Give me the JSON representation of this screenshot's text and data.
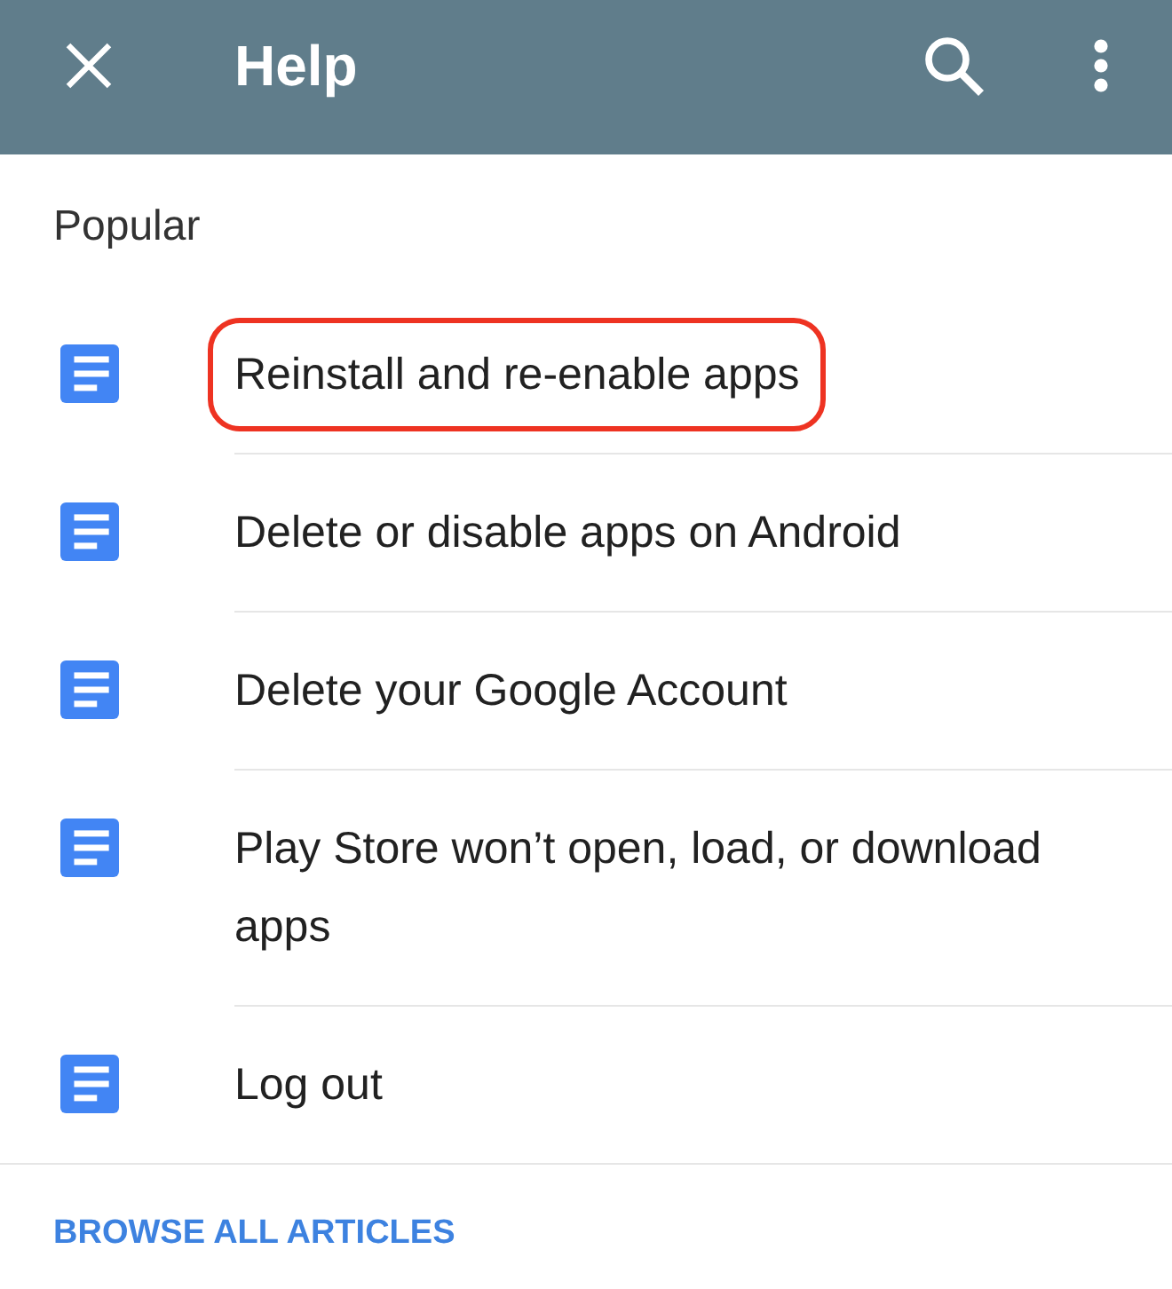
{
  "app_bar": {
    "title": "Help"
  },
  "popular": {
    "heading": "Popular",
    "articles": [
      {
        "title": "Reinstall and re-enable apps",
        "highlighted": true
      },
      {
        "title": "Delete or disable apps on Android",
        "highlighted": false
      },
      {
        "title": "Delete your Google Account",
        "highlighted": false
      },
      {
        "title": "Play Store won’t open, load, or download apps",
        "highlighted": false
      },
      {
        "title": "Log out",
        "highlighted": false
      }
    ]
  },
  "browse_link": {
    "label": "BROWSE ALL ARTICLES"
  }
}
